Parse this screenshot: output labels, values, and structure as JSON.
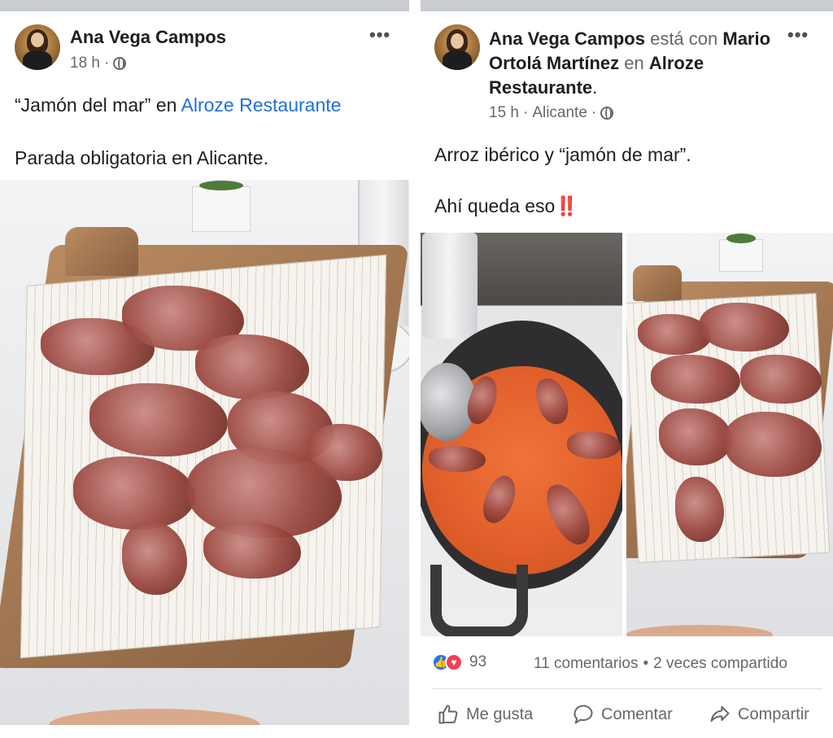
{
  "left_post": {
    "author": "Ana Vega Campos",
    "time": "18 h",
    "separator": "·",
    "text_prefix": "“Jamón del mar” en ",
    "text_link": "Alroze Restaurante",
    "text_line2": "Parada obligatoria en Alicante.",
    "more_label": "•••"
  },
  "right_post": {
    "author": "Ana Vega Campos",
    "with_label": "está con",
    "tagged": "Mario Ortolá Martínez",
    "in_label": "en",
    "place": "Alroze Restaurante",
    "period": ".",
    "time": "15 h",
    "separator": "·",
    "location": "Alicante",
    "separator2": "·",
    "text_line1": "Arroz ibérico y “jamón de mar”.",
    "text_line2": "Ahí queda eso",
    "emoji": "‼️",
    "more_label": "•••",
    "reaction_count": "93",
    "comments": "11 comentarios",
    "dot": "•",
    "shares": "2 veces compartido",
    "actions": {
      "like": "Me gusta",
      "comment": "Comentar",
      "share": "Compartir"
    }
  },
  "colors": {
    "link": "#216fdb",
    "like": "#1877f2",
    "love": "#f33e58",
    "muted": "#65676b"
  },
  "icons": [
    "globe-icon",
    "more-icon",
    "like-icon",
    "comment-icon",
    "share-icon"
  ]
}
